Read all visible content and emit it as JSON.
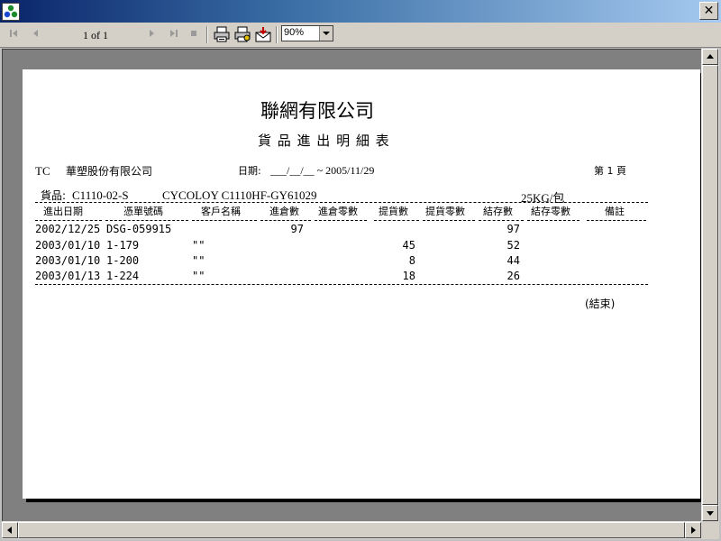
{
  "toolbar": {
    "page_indicator": "1 of 1",
    "zoom_value": "90%"
  },
  "report": {
    "company": "聯網有限公司",
    "title": "貨 品 進 出 明 細 表",
    "code": "TC",
    "customer": "華塑股份有限公司",
    "date_label": "日期:",
    "date_range": "___/__/__ ~ 2005/11/29",
    "page_no": "第 1 頁",
    "product_label": "貨品:",
    "product_code": "C1110-02-S",
    "product_name": "CYCOLOY C1110HF-GY61029",
    "package": "25KG/包",
    "columns": [
      "進出日期",
      "憑單號碼",
      "客戶名稱",
      "進倉數",
      "進倉零數",
      "提貨數",
      "提貨零數",
      "結存數",
      "結存零數",
      "備註"
    ],
    "rows": [
      {
        "date": "2002/12/25",
        "doc": "DSG-059915",
        "customer": "",
        "in_qty": "97",
        "out_qty": "",
        "balance": "97"
      },
      {
        "date": "2003/01/10",
        "doc": "1-179",
        "customer": "\"\"",
        "in_qty": "",
        "out_qty": "45",
        "balance": "52"
      },
      {
        "date": "2003/01/10",
        "doc": "1-200",
        "customer": "\"\"",
        "in_qty": "",
        "out_qty": "8",
        "balance": "44"
      },
      {
        "date": "2003/01/13",
        "doc": "1-224",
        "customer": "\"\"",
        "in_qty": "",
        "out_qty": "18",
        "balance": "26"
      }
    ],
    "end_mark": "(結束)"
  },
  "icons": [
    "first-page-icon",
    "prev-page-icon",
    "next-page-icon",
    "last-page-icon",
    "stop-icon",
    "print-icon",
    "print-setup-icon",
    "export-icon",
    "close-icon",
    "app-icon"
  ],
  "colors": {
    "titlebar_start": "#0a246a",
    "titlebar_end": "#a6caf0",
    "chrome": "#d4d0c8",
    "viewport": "#808080"
  }
}
